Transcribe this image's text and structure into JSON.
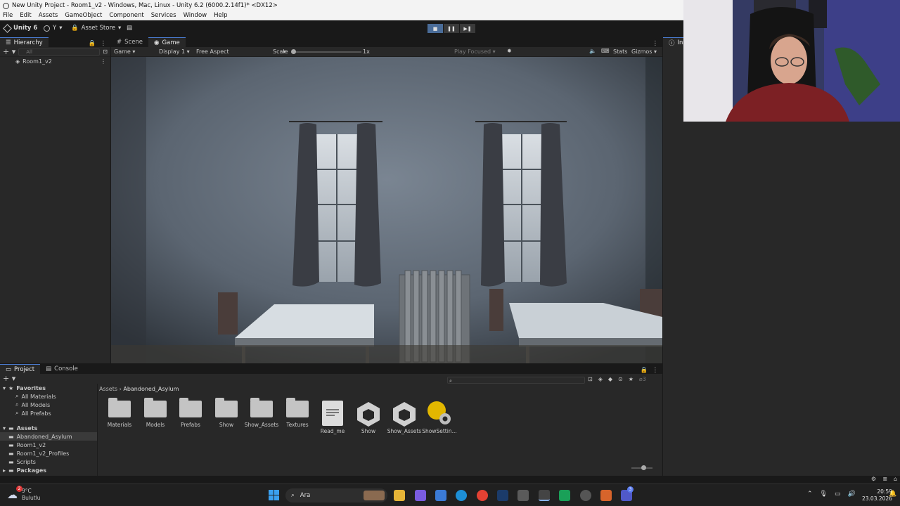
{
  "window": {
    "title": "New Unity Project - Room1_v2 - Windows, Mac, Linux - Unity 6.2 (6000.2.14f1)* <DX12>"
  },
  "menu": [
    "File",
    "Edit",
    "Assets",
    "GameObject",
    "Component",
    "Services",
    "Window",
    "Help"
  ],
  "toolbar": {
    "unity_label": "Unity 6",
    "account_label": "Y",
    "asset_store_label": "Asset Store"
  },
  "hierarchy": {
    "tab": "Hierarchy",
    "search_placeholder": "All",
    "scene": "Room1_v2"
  },
  "game": {
    "tabs": [
      "Scene",
      "Game"
    ],
    "mode": "Game",
    "display": "Display 1",
    "aspect": "Free Aspect",
    "scale_label": "Scale",
    "scale_value": "1x",
    "play_focused": "Play Focused",
    "stats": "Stats",
    "gizmos": "Gizmos"
  },
  "inspector": {
    "tab": "Insp"
  },
  "project": {
    "tabs": [
      "Project",
      "Console"
    ],
    "favorites_label": "Favorites",
    "favorites": [
      "All Materials",
      "All Models",
      "All Prefabs"
    ],
    "assets_label": "Assets",
    "asset_folders": [
      "Abandoned_Asylum",
      "Room1_v2",
      "Room1_v2_Profiles",
      "Scripts"
    ],
    "packages_label": "Packages",
    "breadcrumb": [
      "Assets",
      "Abandoned_Asylum"
    ],
    "hidden_count": "3",
    "items": [
      {
        "name": "Materials",
        "kind": "folder"
      },
      {
        "name": "Models",
        "kind": "folder"
      },
      {
        "name": "Prefabs",
        "kind": "folder"
      },
      {
        "name": "Show",
        "kind": "folder"
      },
      {
        "name": "Show_Assets",
        "kind": "folder"
      },
      {
        "name": "Textures",
        "kind": "folder"
      },
      {
        "name": "Read_me",
        "kind": "text"
      },
      {
        "name": "Show",
        "kind": "unity"
      },
      {
        "name": "Show_Assets",
        "kind": "unity"
      },
      {
        "name": "ShowSettin...",
        "kind": "settings"
      }
    ]
  },
  "taskbar": {
    "weather_temp": "9°C",
    "weather_desc": "Bulutlu",
    "weather_badge": "2",
    "search_placeholder": "Ara",
    "time": "20:59",
    "date": "23.03.2026",
    "teams_badge": "3"
  },
  "colors": {
    "editor_bg": "#282828",
    "toolbar_bg": "#191919",
    "accent": "#4a7bd0",
    "play_active": "#4a6c98"
  }
}
